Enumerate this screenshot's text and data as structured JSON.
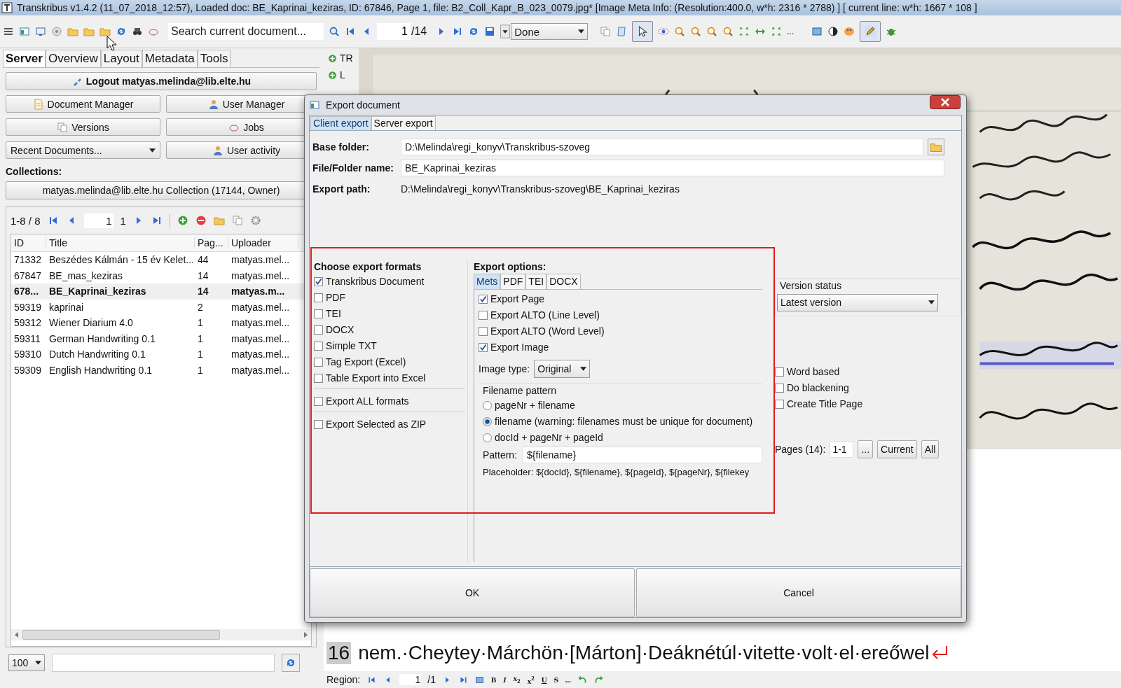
{
  "window": {
    "title": "Transkribus v1.4.2 (11_07_2018_12:57), Loaded doc: BE_Kaprinai_keziras, ID: 67846, Page 1, file: B2_Coll_Kapr_B_023_0079.jpg* [Image Meta Info: (Resolution:400.0, w*h: 2316 * 2788) ] [ current line: w*h: 1667 * 108 ]"
  },
  "toolbar": {
    "search": {
      "placeholder": "Search current document..."
    },
    "page": "1",
    "page_total": "/14",
    "status": "Done",
    "overflow_mark": "..."
  },
  "left_panel": {
    "tabs": [
      {
        "label": "Server",
        "selected": true
      },
      {
        "label": "Overview",
        "selected": false
      },
      {
        "label": "Layout",
        "selected": false
      },
      {
        "label": "Metadata",
        "selected": false
      },
      {
        "label": "Tools",
        "selected": false
      }
    ],
    "logout_button": "Logout matyas.melinda@lib.elte.hu",
    "buttons": [
      {
        "label": "Document Manager",
        "kind": "button"
      },
      {
        "label": "User Manager",
        "kind": "button"
      },
      {
        "label": "Versions",
        "kind": "button"
      },
      {
        "label": "Jobs",
        "kind": "button"
      },
      {
        "label": "Recent Documents...",
        "kind": "dropdown"
      },
      {
        "label": "User activity",
        "kind": "button"
      }
    ],
    "collections_label": "Collections:",
    "collection_button": "matyas.melinda@lib.elte.hu Collection (17144, Owner)",
    "documents": {
      "range": "1-8 / 8",
      "page": "1",
      "page_total": "1",
      "columns": [
        "ID",
        "Title",
        "Pag...",
        "Uploader"
      ],
      "rows": [
        {
          "cells": [
            "71332",
            "Beszédes Kálmán - 15 év Kelet...",
            "44",
            "matyas.mel..."
          ],
          "selected": false
        },
        {
          "cells": [
            "67847",
            "BE_mas_keziras",
            "14",
            "matyas.mel..."
          ],
          "selected": false
        },
        {
          "cells": [
            "678...",
            "BE_Kaprinai_keziras",
            "14",
            "matyas.m..."
          ],
          "selected": true
        },
        {
          "cells": [
            "59319",
            "kaprinai",
            "2",
            "matyas.mel..."
          ],
          "selected": false
        },
        {
          "cells": [
            "59312",
            "Wiener Diarium 4.0",
            "1",
            "matyas.mel..."
          ],
          "selected": false
        },
        {
          "cells": [
            "59311",
            "German Handwriting 0.1",
            "1",
            "matyas.mel..."
          ],
          "selected": false
        },
        {
          "cells": [
            "59310",
            "Dutch Handwriting 0.1",
            "1",
            "matyas.mel..."
          ],
          "selected": false
        },
        {
          "cells": [
            "59309",
            "English Handwriting 0.1",
            "1",
            "matyas.mel..."
          ],
          "selected": false
        }
      ]
    },
    "zoom_select": "100"
  },
  "tags": [
    "TR",
    "L"
  ],
  "transcription": {
    "line_number": "16",
    "text": "nem.·Cheytey·Márchön·[Márton]·Deáknétúl·vitette·volt·el·ereőwel"
  },
  "region_toolbar": {
    "label": "Region:",
    "page": "1",
    "page_total": "/1",
    "format_buttons": [
      "B",
      "I",
      "x$_{2}$",
      "x$^{2}$",
      "U",
      "S",
      "..."
    ]
  },
  "dialog": {
    "title": "Export document",
    "tabs": [
      {
        "label": "Client export",
        "selected": true
      },
      {
        "label": "Server export",
        "selected": false
      }
    ],
    "base_folder": {
      "label": "Base folder:",
      "value": "D:\\Melinda\\regi_konyv\\Transkribus-szoveg"
    },
    "file_name": {
      "label": "File/Folder name:",
      "value": "BE_Kaprinai_keziras"
    },
    "export_path": {
      "label": "Export path:",
      "value": "D:\\Melinda\\regi_konyv\\Transkribus-szoveg\\BE_Kaprinai_keziras"
    },
    "formats": {
      "title": "Choose export formats",
      "groups": [
        [
          {
            "label": "Transkribus Document",
            "checked": true
          },
          {
            "label": "PDF",
            "checked": false
          },
          {
            "label": "TEI",
            "checked": false
          },
          {
            "label": "DOCX",
            "checked": false
          },
          {
            "label": "Simple TXT",
            "checked": false
          },
          {
            "label": "Tag Export (Excel)",
            "checked": false
          },
          {
            "label": "Table Export into Excel",
            "checked": false
          }
        ],
        [
          {
            "label": "Export ALL formats",
            "checked": false
          }
        ],
        [
          {
            "label": "Export Selected as ZIP",
            "checked": false
          }
        ]
      ]
    },
    "options": {
      "title": "Export options:",
      "tabs": [
        {
          "label": "Mets",
          "selected": true
        },
        {
          "label": "PDF",
          "selected": false
        },
        {
          "label": "TEI",
          "selected": false
        },
        {
          "label": "DOCX",
          "selected": false
        }
      ],
      "checks": [
        {
          "label": "Export Page",
          "checked": true
        },
        {
          "label": "Export ALTO (Line Level)",
          "checked": false
        },
        {
          "label": "Export ALTO (Word Level)",
          "checked": false
        },
        {
          "label": "Export Image",
          "checked": true
        }
      ],
      "image_type": {
        "label": "Image type:",
        "value": "Original"
      },
      "filename_pattern": {
        "title": "Filename pattern",
        "choices": [
          {
            "label": "pageNr + filename",
            "selected": false
          },
          {
            "label": "filename (warning: filenames must be unique for document)",
            "selected": true
          },
          {
            "label": "docId + pageNr + pageId",
            "selected": false
          }
        ]
      },
      "pattern": {
        "label": "Pattern:",
        "value": "${filename}"
      },
      "placeholder_note": "Placeholder: ${docId}, ${filename}, ${pageId}, ${pageNr}, ${filekey"
    },
    "version_status": {
      "title": "Version status",
      "value": "Latest version"
    },
    "extra_checks": [
      {
        "label": "Word based",
        "checked": false
      },
      {
        "label": "Do blackening",
        "checked": false
      },
      {
        "label": "Create Title Page",
        "checked": false
      }
    ],
    "pages": {
      "label": "Pages (14):",
      "value": "1-1",
      "buttons": [
        "...",
        "Current",
        "All"
      ]
    },
    "buttons": [
      "OK",
      "Cancel"
    ]
  }
}
